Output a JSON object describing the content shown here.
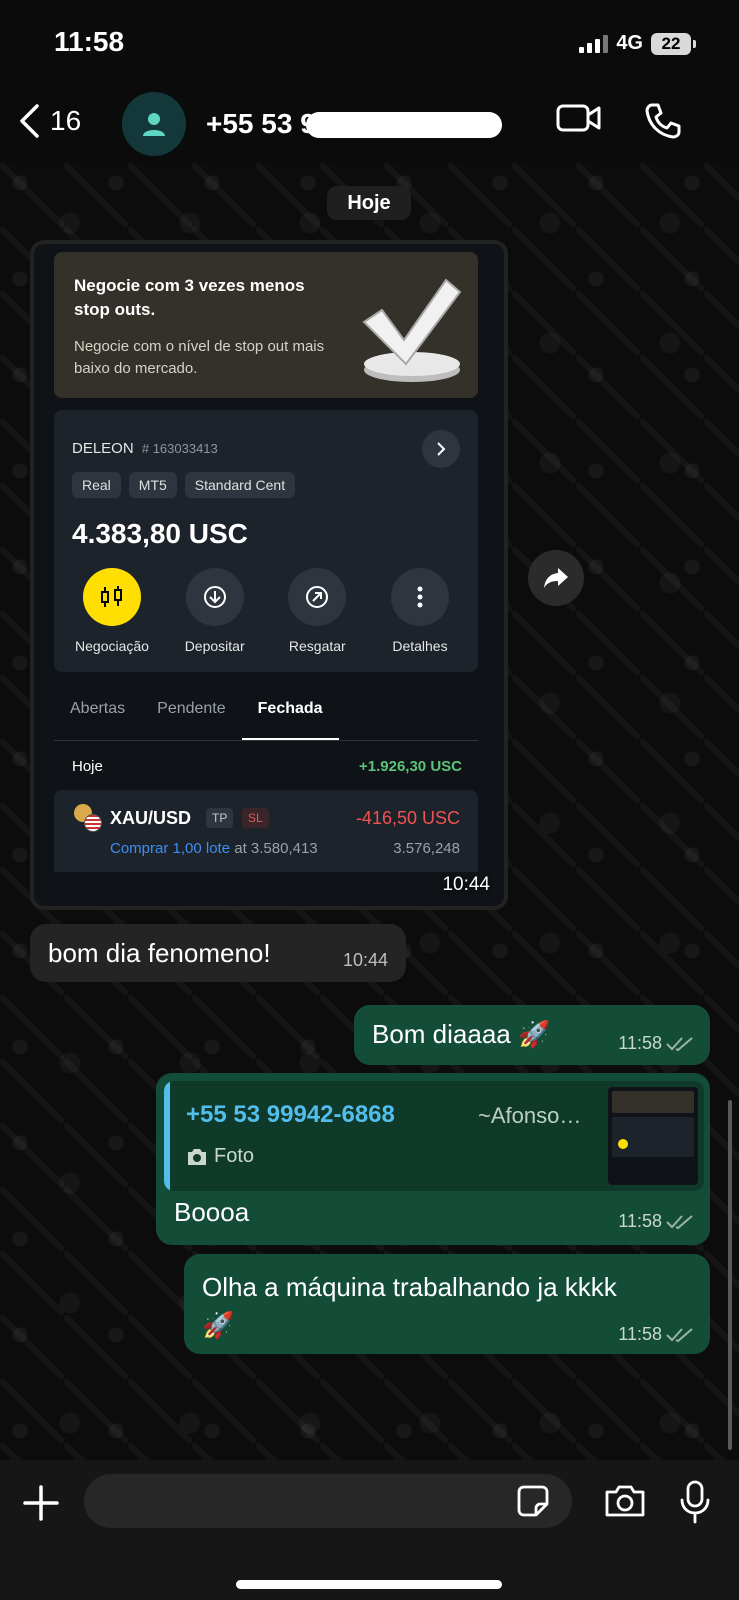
{
  "status": {
    "time": "11:58",
    "network": "4G",
    "battery": "22"
  },
  "header": {
    "back_count": "16",
    "contact": "+55 53 9"
  },
  "day_label": "Hoje",
  "image_message": {
    "promo_title": "Negocie com 3 vezes menos stop outs.",
    "promo_sub": "Negocie com o nível de stop out mais baixo do mercado.",
    "account_name": "DELEON",
    "account_id": "# 163033413",
    "tags": [
      "Real",
      "MT5",
      "Standard Cent"
    ],
    "balance": "4.383,80 USC",
    "actions": [
      "Negociação",
      "Depositar",
      "Resgatar",
      "Detalhes"
    ],
    "tabs": [
      "Abertas",
      "Pendente",
      "Fechada"
    ],
    "day": "Hoje",
    "day_pnl": "+1.926,30 USC",
    "trade": {
      "symbol": "XAU/USD",
      "tp": "TP",
      "sl": "SL",
      "pnl": "-416,50 USC",
      "side": "Comprar 1,00 lote",
      "at": "at 3.580,413",
      "close": "3.576,248"
    },
    "time": "10:44"
  },
  "incoming": {
    "text": "bom dia fenomeno!",
    "time": "10:44"
  },
  "outgoing": [
    {
      "text": "Bom diaaaa",
      "emoji": "🚀",
      "time": "11:58"
    },
    {
      "quote_number": "+55 53 99942-6868",
      "quote_name": "~Afonso…",
      "quote_media": "Foto",
      "text": "Boooa",
      "time": "11:58"
    },
    {
      "text": "Olha a máquina trabalhando ja kkkk",
      "emoji": "🚀",
      "time": "11:58"
    }
  ],
  "composer": {
    "placeholder": ""
  },
  "colors": {
    "outgoing_bubble": "#144d37",
    "incoming_bubble": "#242424",
    "accent_blue": "#53bdeb",
    "exness_yellow": "#ffde02"
  }
}
